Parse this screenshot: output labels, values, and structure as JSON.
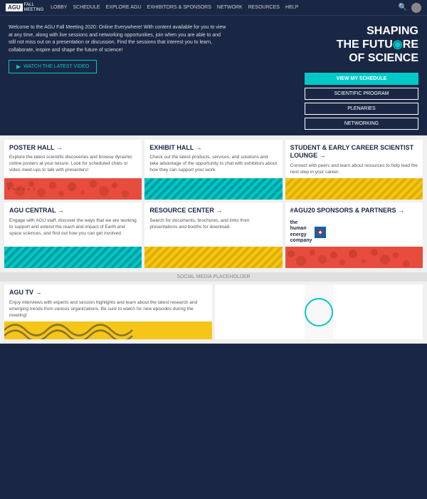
{
  "nav": {
    "logo": "AGU",
    "logo_sub": "FALL\nMEETING",
    "links": [
      "LOBBY",
      "SCHEDULE",
      "EXPLORE AGU",
      "EXHIBITORS & SPONSORS",
      "NETWORK",
      "RESOURCES",
      "HELP"
    ]
  },
  "hero": {
    "tagline": "Welcome to the AGU Fall Meeting 2020: Online Everywhere!\nWith content available for you to view at any time, along with\nlive sessions and networking opportunities, join when you are\nable to and still not miss out on a presentation or discussion.\nFind the sessions that interest you to learn, collaborate, inspire\nand shape the future of science!",
    "cta_label": "WATCH THE LATEST VIDEO",
    "title_line1": "SHAPING",
    "title_line2": "THE FUTURE",
    "title_line3": "OF SCIENCE",
    "btn1": "VIEW MY SCHEDULE",
    "btn2": "SCIENTIFIC PROGRAM",
    "btn3": "PLENARIES",
    "btn4": "NETWORKING"
  },
  "cards": [
    {
      "title": "POSTER HALL →",
      "desc": "Explore the latest scientific discoveries and browse dynamic online posters at your leisure. Look for scheduled chats or video meet-ups to talk with presenters!",
      "pattern": "red-dots"
    },
    {
      "title": "EXHIBIT HALL →",
      "desc": "Check out the latest products, services, and solutions and take advantage of the opportunity to chat with exhibitors about how they can support your work.",
      "pattern": "cyan-stripe"
    },
    {
      "title": "STUDENT & EARLY CAREER SCIENTIST LOUNGE →",
      "desc": "Connect with peers and learn about resources to help lead the next step in your career.",
      "pattern": "yellow-stripe"
    },
    {
      "title": "AGU CENTRAL →",
      "desc": "Engage with AGU staff, discover the ways that we are working to support and extend the reach and impact of Earth and space sciences, and find out how you can get involved.",
      "pattern": "cyan-stripe"
    },
    {
      "title": "RESOURCE CENTER →",
      "desc": "Search for documents, brochures, and links from presentations and booths for download.",
      "pattern": "yellow-stripe"
    },
    {
      "title": "#AGU20 SPONSORS & PARTNERS →",
      "desc": "",
      "pattern": "red-dots",
      "sponsor": true
    }
  ],
  "social_placeholder": "SOCIAL MEDIA PLACEHOLDER",
  "tv_card": {
    "title": "AGU TV →",
    "desc": "Enjoy interviews with experts and session highlights and learn about the latest research and emerging trends from various organizations. Be sure to watch for new episodes during the meeting!",
    "pattern": "yellow"
  },
  "sponsor_logo": {
    "line1": "the",
    "line2": "human",
    "line3": "energy",
    "line4": "company"
  }
}
